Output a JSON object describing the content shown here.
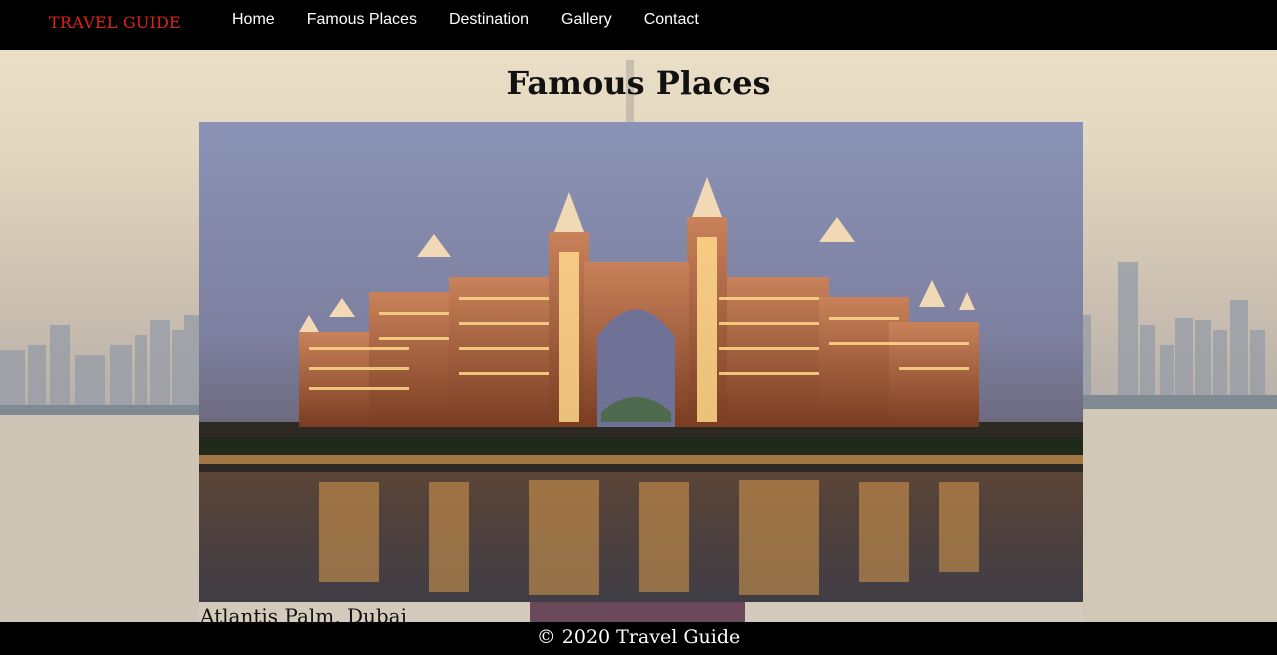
{
  "navbar": {
    "brand": "TRAVEL GUIDE",
    "links": [
      {
        "label": "Home"
      },
      {
        "label": "Famous Places"
      },
      {
        "label": "Destination"
      },
      {
        "label": "Gallery"
      },
      {
        "label": "Contact"
      }
    ]
  },
  "main": {
    "title": "Famous Places",
    "featured": {
      "caption": "Atlantis Palm, Dubai"
    }
  },
  "footer": {
    "text": "© 2020 Travel Guide"
  },
  "colors": {
    "brand": "#e0231a",
    "nav_background": "#000000",
    "nav_text": "#ffffff"
  }
}
